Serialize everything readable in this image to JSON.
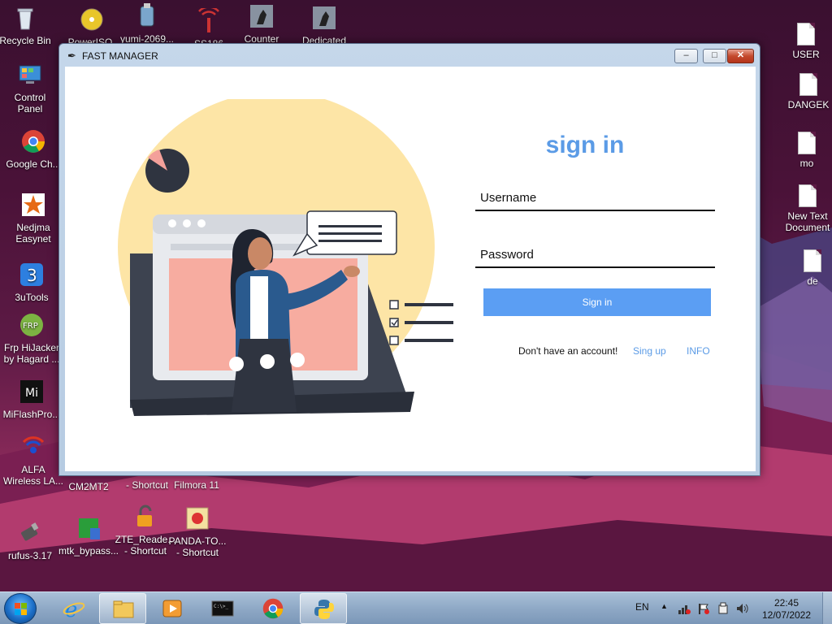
{
  "desktop": {
    "icons_left": [
      {
        "name": "recycle-bin",
        "label": "Recycle Bin"
      },
      {
        "name": "control-panel",
        "label": "Control\nPanel"
      },
      {
        "name": "google-chrome",
        "label": "Google Ch..."
      },
      {
        "name": "nedjma-easynet",
        "label": "Nedjma\nEasynet"
      },
      {
        "name": "3utools",
        "label": "3uTools"
      },
      {
        "name": "frp-hijacker",
        "label": "Frp HiJacker\nby Hagard ..."
      },
      {
        "name": "miflashpro",
        "label": "MiFlashPro..."
      },
      {
        "name": "alfa-wireless",
        "label": "ALFA\nWireless LA..."
      },
      {
        "name": "rufus",
        "label": "rufus-3.17"
      }
    ],
    "icons_top": [
      {
        "name": "poweriso",
        "label": "PowerISO"
      },
      {
        "name": "yumi",
        "label": "yumi-2069..."
      },
      {
        "name": "ss186",
        "label": "SS186"
      },
      {
        "name": "counter",
        "label": "Counter"
      },
      {
        "name": "dedicated",
        "label": "Dedicated"
      }
    ],
    "icons_right": [
      {
        "name": "user-doc",
        "label": "USER"
      },
      {
        "name": "dangek-doc",
        "label": "DANGEK"
      },
      {
        "name": "mo-doc",
        "label": "mo"
      },
      {
        "name": "new-text-doc",
        "label": "New Text\nDocument"
      },
      {
        "name": "de-doc",
        "label": "de"
      }
    ],
    "icons_bottom": [
      {
        "name": "cm2mt2",
        "label": "CM2MT2"
      },
      {
        "name": "shortcut-1",
        "label": "- Shortcut"
      },
      {
        "name": "filmora",
        "label": "Filmora 11"
      },
      {
        "name": "mtk-bypass",
        "label": "mtk_bypass..."
      },
      {
        "name": "zte-reader",
        "label": "ZTE_Reade...\n- Shortcut"
      },
      {
        "name": "panda-tool",
        "label": "PANDA-TO...\n- Shortcut"
      }
    ]
  },
  "window": {
    "title": "FAST MANAGER",
    "min_label": "–",
    "max_label": "□",
    "close_label": "✕"
  },
  "form": {
    "title": "sign in",
    "username_placeholder": "Username",
    "password_placeholder": "Password",
    "signin_label": "Sign in",
    "no_account": "Don't have an account!",
    "signup_link": "Sing up",
    "info_link": "INFO"
  },
  "taskbar": {
    "lang": "EN",
    "time": "22:45",
    "date": "12/07/2022"
  }
}
